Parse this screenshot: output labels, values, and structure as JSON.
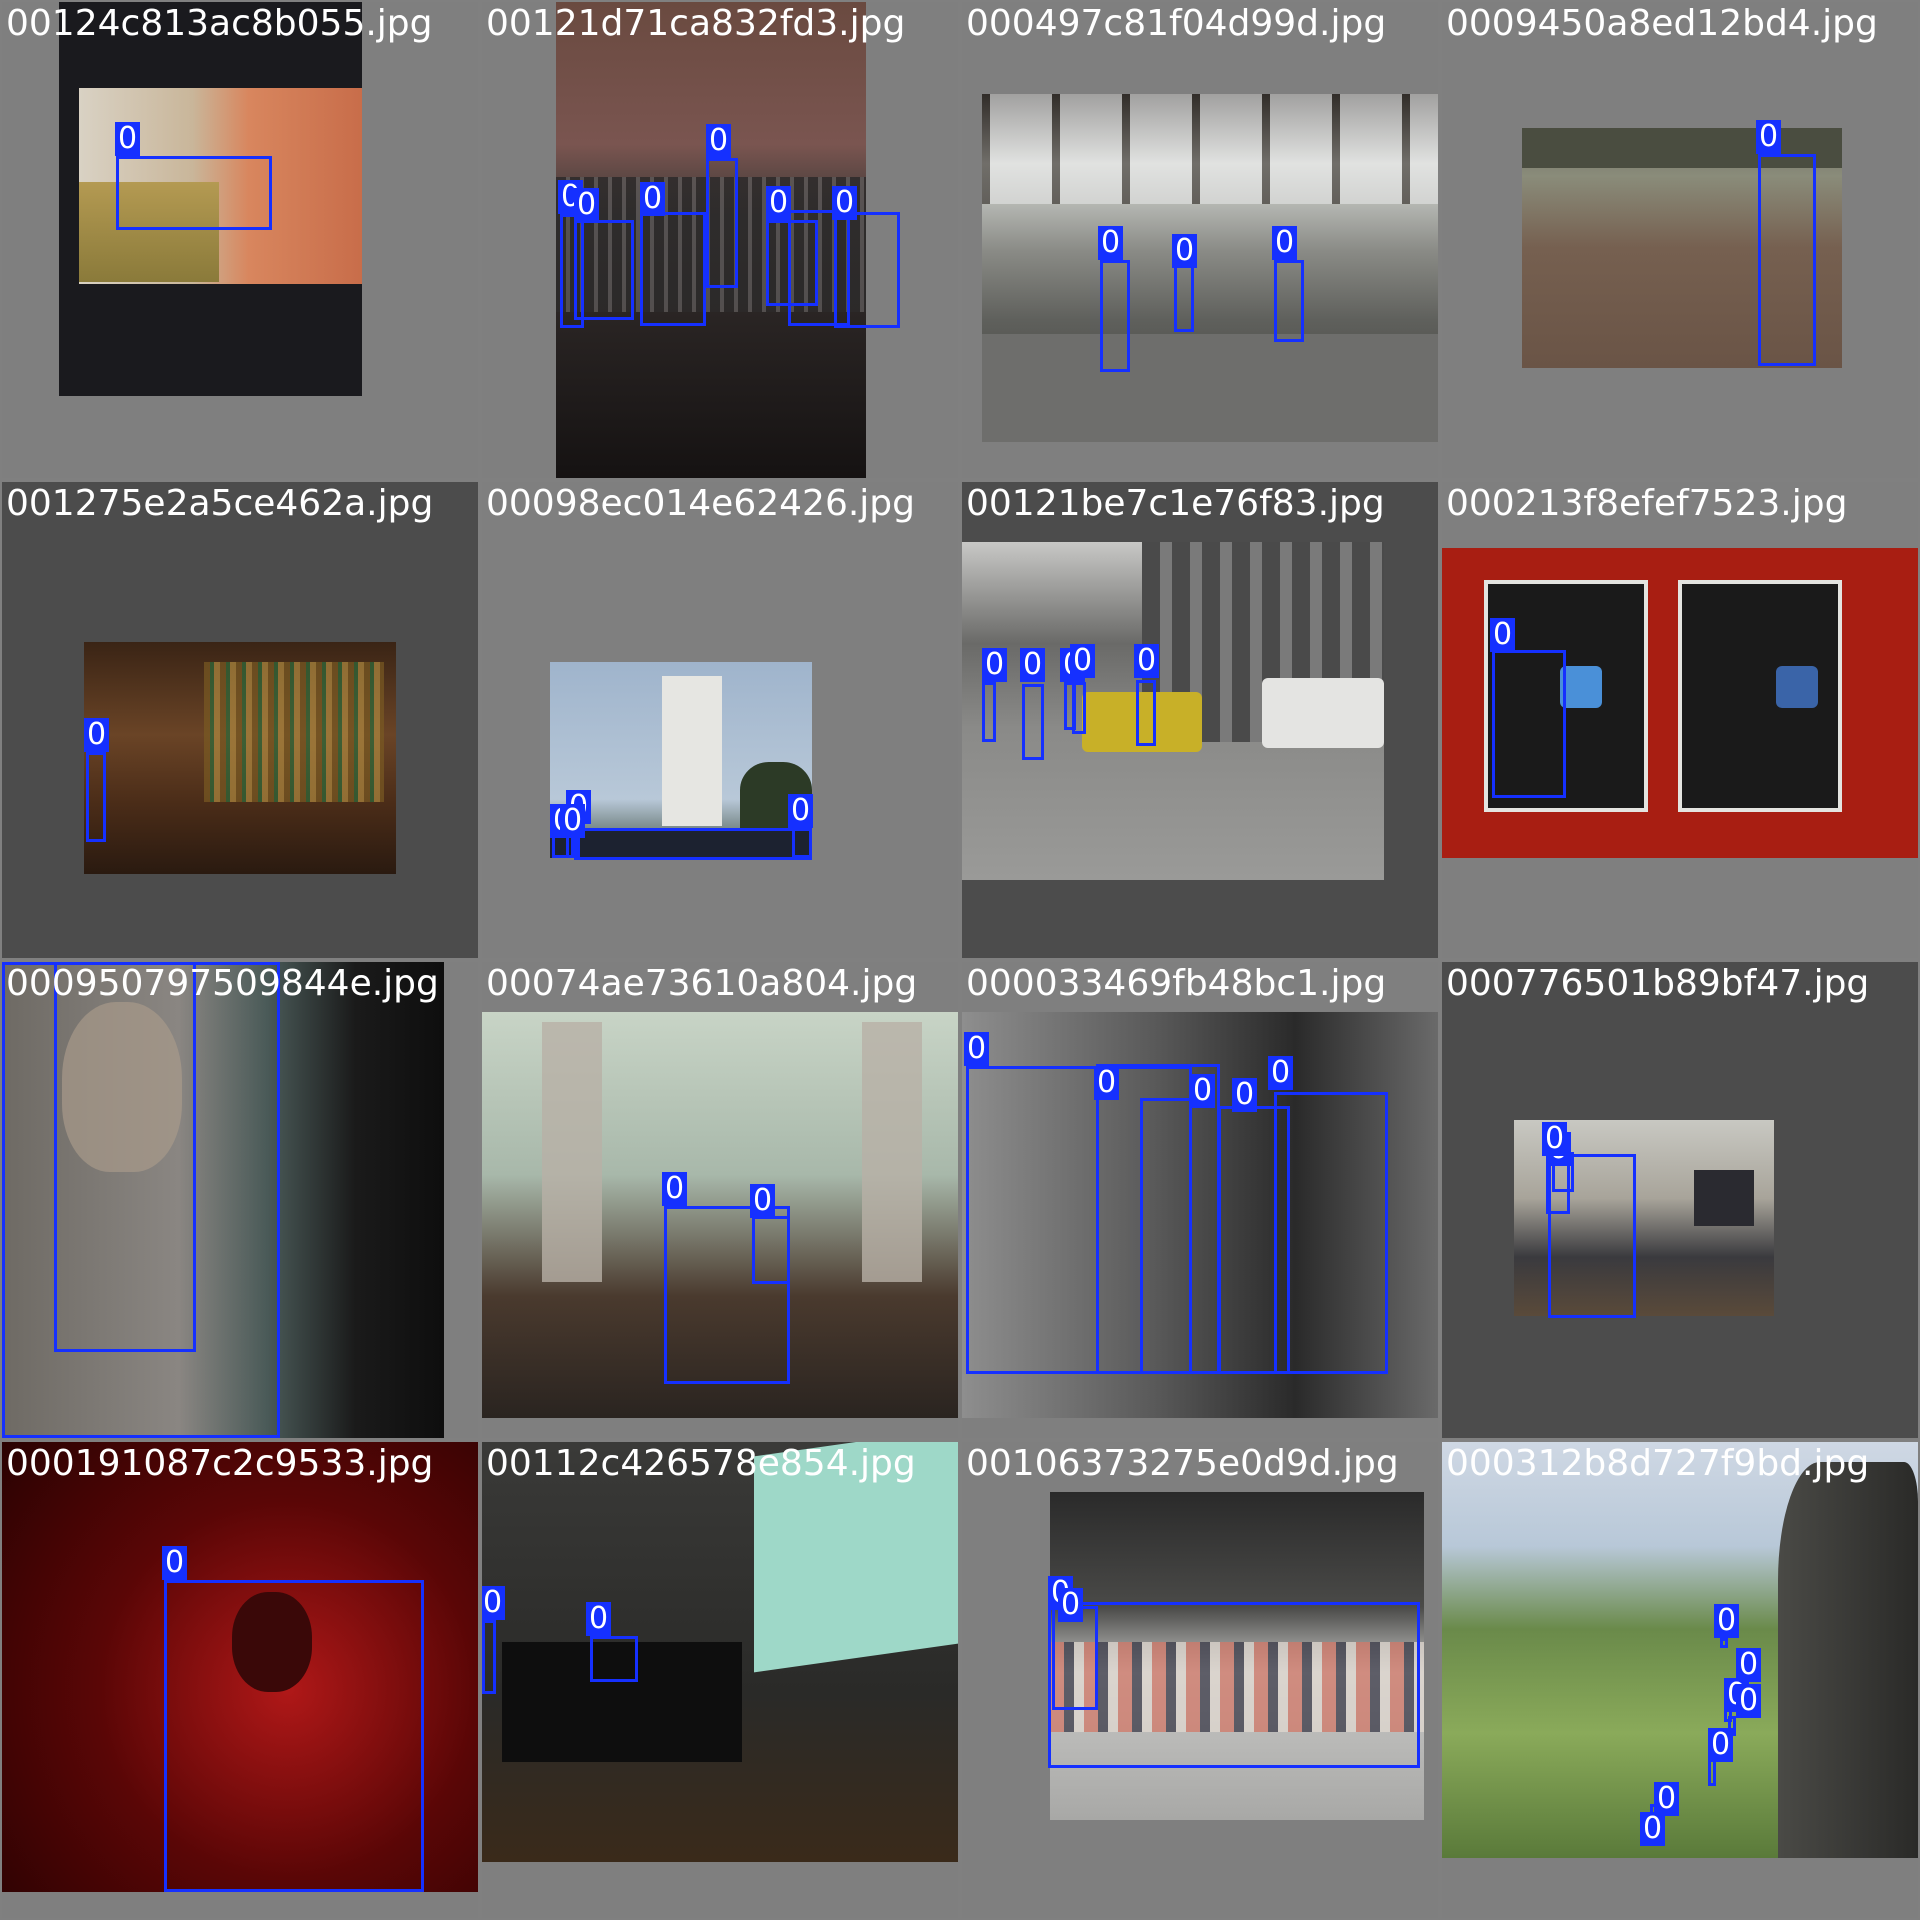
{
  "box_color": "#1530ff",
  "images": [
    {
      "filename": "00124c813ac8b055.jpg",
      "labels": [
        "0"
      ]
    },
    {
      "filename": "00121d71ca832fd3.jpg",
      "labels": [
        "0",
        "0",
        "0",
        "0",
        "0",
        "0",
        "0"
      ]
    },
    {
      "filename": "000497c81f04d99d.jpg",
      "labels": [
        "0",
        "0",
        "0"
      ]
    },
    {
      "filename": "0009450a8ed12bd4.jpg",
      "labels": [
        "0"
      ]
    },
    {
      "filename": "001275e2a5ce462a.jpg",
      "labels": [
        "0"
      ]
    },
    {
      "filename": "00098ec014e62426.jpg",
      "labels": [
        "0",
        "0",
        "0",
        "0"
      ]
    },
    {
      "filename": "00121be7c1e76f83.jpg",
      "labels": [
        "0",
        "0",
        "0",
        "0",
        "0"
      ]
    },
    {
      "filename": "000213f8efef7523.jpg",
      "labels": [
        "0"
      ]
    },
    {
      "filename": "000950797509844e.jpg",
      "labels": [
        "0",
        "0"
      ]
    },
    {
      "filename": "00074ae73610a804.jpg",
      "labels": [
        "0",
        "0"
      ]
    },
    {
      "filename": "000033469fb48bc1.jpg",
      "labels": [
        "0",
        "0",
        "0",
        "0",
        "0"
      ]
    },
    {
      "filename": "000776501b89bf47.jpg",
      "labels": [
        "0",
        "0"
      ]
    },
    {
      "filename": "000191087c2c9533.jpg",
      "labels": [
        "0"
      ]
    },
    {
      "filename": "00112c426578e854.jpg",
      "labels": [
        "0",
        "0"
      ]
    },
    {
      "filename": "00106373275e0d9d.jpg",
      "labels": [
        "0",
        "0"
      ]
    },
    {
      "filename": "000312b8d727f9bd.jpg",
      "labels": [
        "0",
        "0",
        "0",
        "0",
        "0",
        "0",
        "0"
      ]
    }
  ]
}
